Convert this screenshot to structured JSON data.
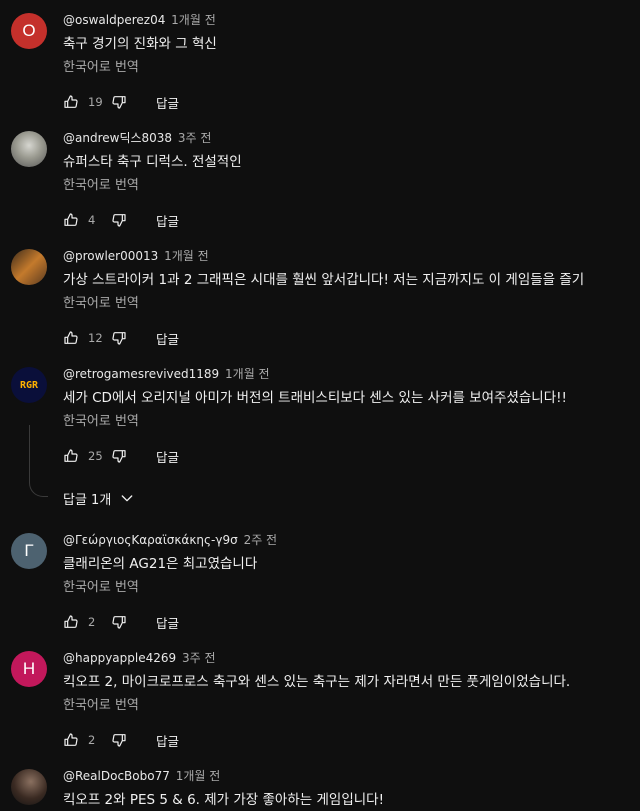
{
  "comments": [
    {
      "author": "@oswaldperez04",
      "time": "1개월 전",
      "text": "축구 경기의 진화와 그 혁신",
      "translate": "한국어로 번역",
      "likes": "19",
      "reply": "답글",
      "avatar": {
        "letter": "O",
        "color": "#c4302b"
      }
    },
    {
      "author": "@andrew딕스8038",
      "time": "3주 전",
      "text": "슈퍼스타 축구 디럭스. 전설적인",
      "translate": "한국어로 번역",
      "likes": "4",
      "reply": "답글",
      "avatar": {
        "letter": "",
        "color": "#8a8a80"
      }
    },
    {
      "author": "@prowler00013",
      "time": "1개월 전",
      "text": "가상 스트라이커 1과 2 그래픽은 시대를 훨씬 앞서갑니다! 저는 지금까지도 이 게임들을 즐기",
      "translate": "한국어로 번역",
      "likes": "12",
      "reply": "답글",
      "avatar": {
        "letter": "",
        "color": "#8a5a2a"
      }
    },
    {
      "author": "@retrogamesrevived1189",
      "time": "1개월 전",
      "text": "세가 CD에서 오리지널 아미가 버전의 트래비스티보다 센스 있는 사커를 보여주셨습니다!!",
      "translate": "한국어로 번역",
      "likes": "25",
      "reply": "답글",
      "avatar": {
        "letter": "RGR",
        "color": "#0a0f3a"
      },
      "replies_label": "답글 1개"
    },
    {
      "author": "@ΓεώργιοςΚαραϊσκάκης-γ9σ",
      "time": "2주 전",
      "text": "클래리온의 AG21은 최고였습니다",
      "translate": "한국어로 번역",
      "likes": "2",
      "reply": "답글",
      "avatar": {
        "letter": "Γ",
        "color": "#4d6270"
      }
    },
    {
      "author": "@happyapple4269",
      "time": "3주 전",
      "text": "킥오프 2, 마이크로프로스 축구와 센스 있는 축구는 제가 자라면서 만든 풋게임이었습니다.",
      "translate": "한국어로 번역",
      "likes": "2",
      "reply": "답글",
      "avatar": {
        "letter": "H",
        "color": "#c2185b"
      }
    },
    {
      "author": "@RealDocBobo77",
      "time": "1개월 전",
      "text": "킥오프 2와 PES 5 & 6. 제가 가장 좋아하는 게임입니다!",
      "translate": "",
      "likes": "",
      "reply": "",
      "avatar": {
        "letter": "",
        "color": "#2a2a2a"
      }
    }
  ],
  "colors": {
    "background": "#0f0f0f",
    "text": "#f1f1f1",
    "secondary": "#aaaaaa"
  },
  "icons": {
    "like": "thumb-up-icon",
    "dislike": "thumb-down-icon",
    "expand": "chevron-down-icon"
  }
}
